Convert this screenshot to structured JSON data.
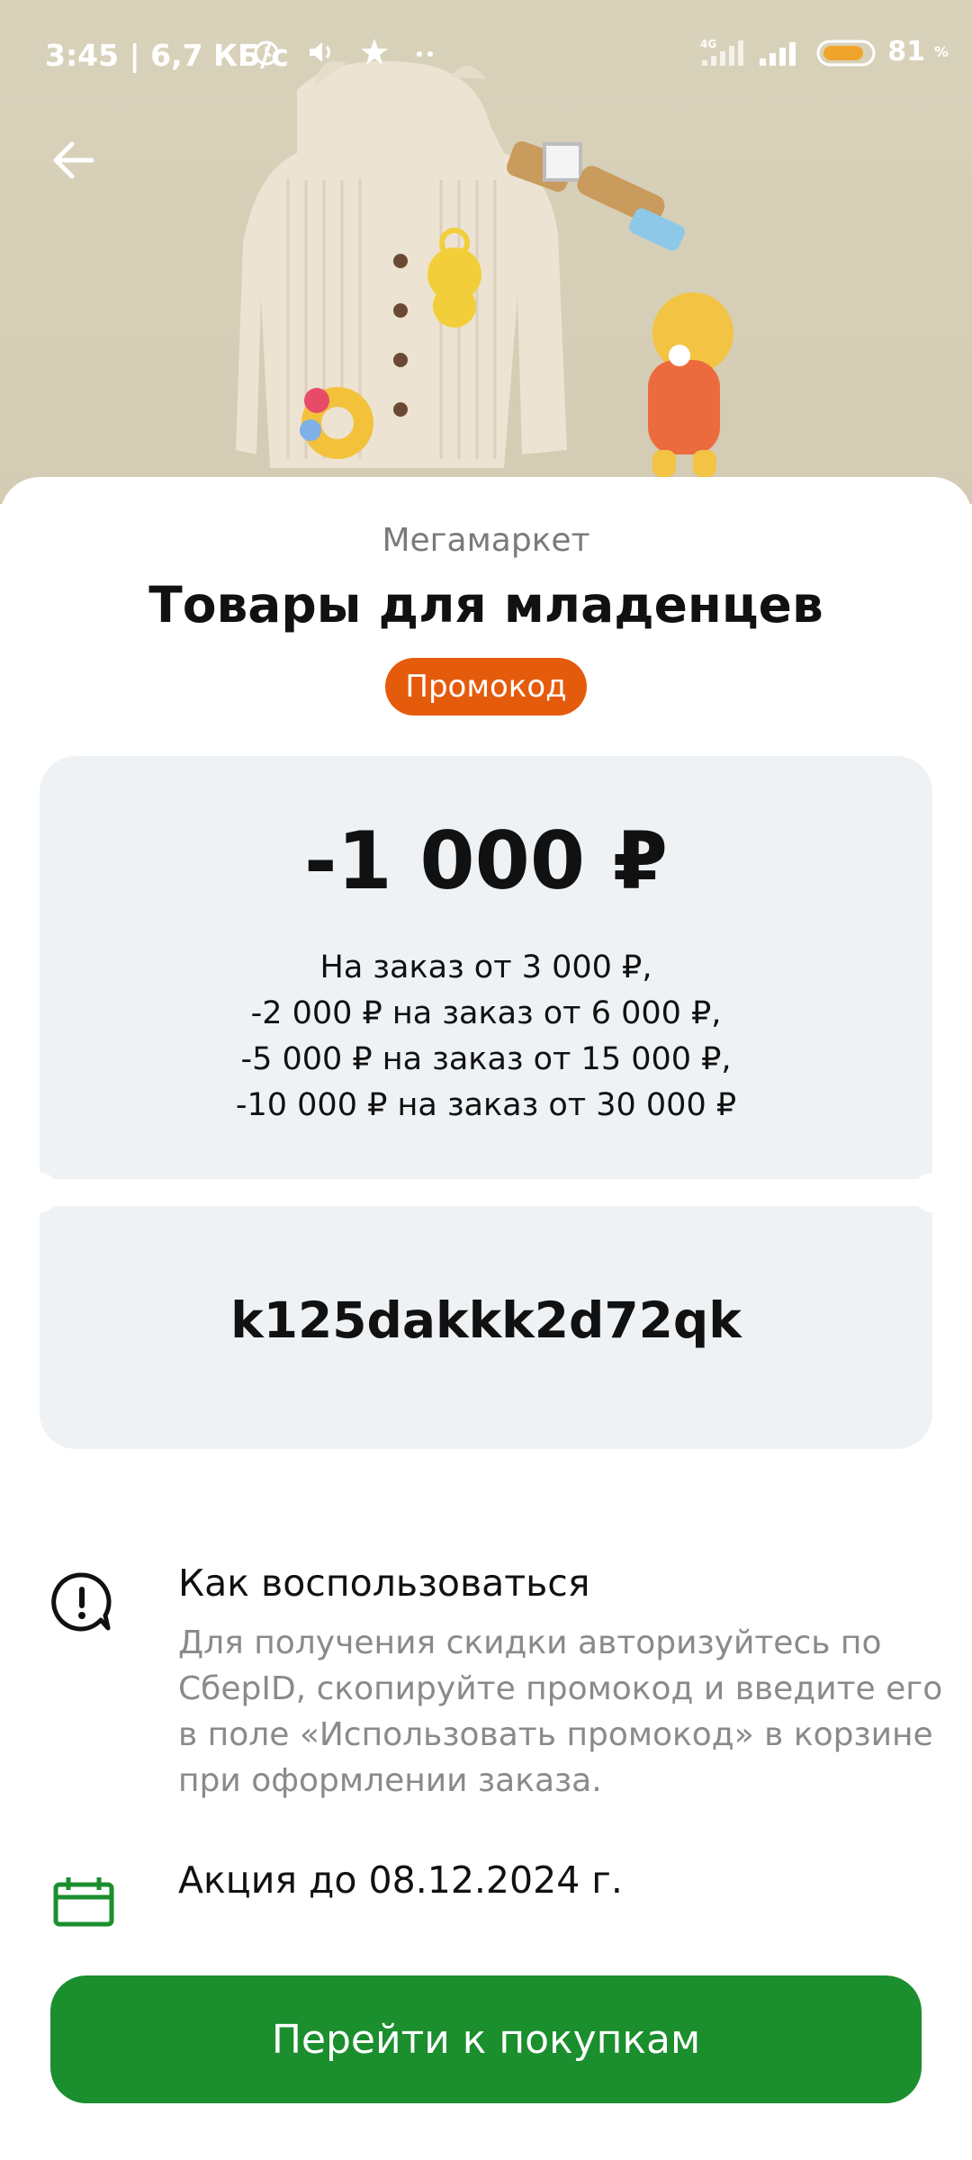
{
  "status_bar": {
    "time_speed": "3:45 | 6,7 КБ/с",
    "network": "4G",
    "battery_level": "81",
    "battery_percent": "%",
    "icons": [
      "alarm-icon",
      "volume-icon",
      "star-icon",
      "more-dots-icon",
      "signal-4g-icon",
      "signal-icon",
      "battery-icon"
    ]
  },
  "hero": {
    "image_desc_icon": "baby-products-photo"
  },
  "card": {
    "brand": "Мегамаркет",
    "title": "Товары для младенцев",
    "badge": "Промокод",
    "amount": "-1 000 ₽",
    "conditions": [
      "На заказ от 3 000 ₽,",
      "-2 000 ₽ на заказ от 6 000 ₽,",
      "-5 000 ₽ на заказ от 15 000 ₽,",
      "-10 000 ₽ на заказ от 30 000 ₽"
    ],
    "code": "k125dakkk2d72qk"
  },
  "how_to": {
    "title": "Как воспользоваться",
    "text": "Для получения скидки авторизуйтесь по СберID, скопируйте промокод и введите его в поле «Использовать промокод» в корзине при оформлении заказа."
  },
  "promo_period": "Акция до 08.12.2024 г.",
  "cta_label": "Перейти к покупкам",
  "colors": {
    "badge": "#e55b0c",
    "cta": "#1b8e2d",
    "ticket": "#eff2f5"
  }
}
